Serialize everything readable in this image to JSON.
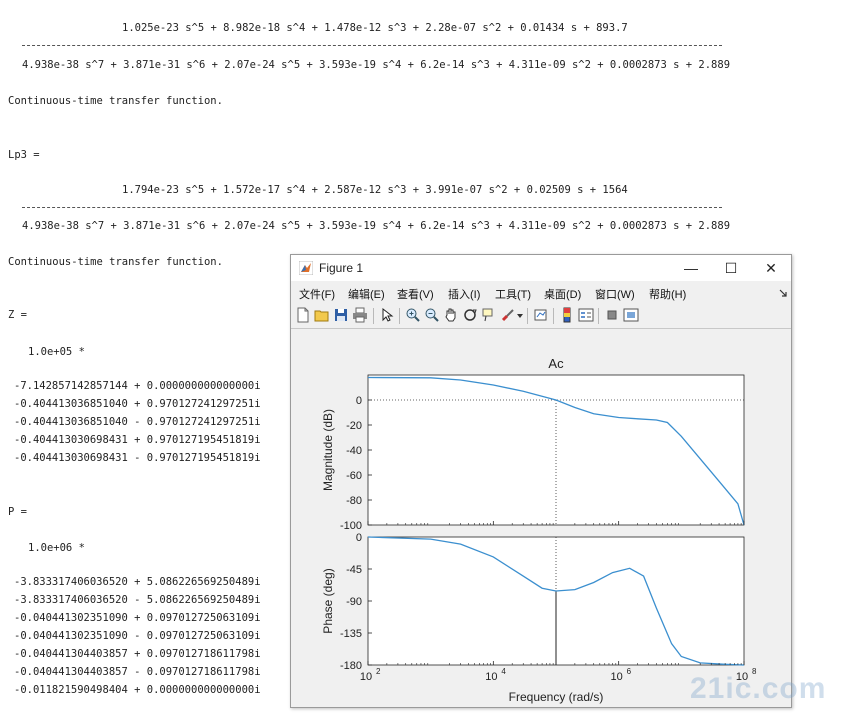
{
  "console": {
    "tf1": {
      "numerator": "1.025e-23 s^5 + 8.982e-18 s^4 + 1.478e-12 s^3 + 2.28e-07 s^2 + 0.01434 s + 893.7",
      "denominator": "4.938e-38 s^7 + 3.871e-31 s^6 + 2.07e-24 s^5 + 3.593e-19 s^4 + 6.2e-14 s^3 + 4.311e-09 s^2 + 0.0002873 s + 2.889",
      "note": "Continuous-time transfer function."
    },
    "lp3": {
      "label": "Lp3 =",
      "numerator": "1.794e-23 s^5 + 1.572e-17 s^4 + 2.587e-12 s^3 + 3.991e-07 s^2 + 0.02509 s + 1564",
      "denominator": "4.938e-38 s^7 + 3.871e-31 s^6 + 2.07e-24 s^5 + 3.593e-19 s^4 + 6.2e-14 s^3 + 4.311e-09 s^2 + 0.0002873 s + 2.889",
      "note": "Continuous-time transfer function."
    },
    "z": {
      "label": "Z =",
      "scale": "1.0e+05 *",
      "values": [
        "-7.142857142857144 + 0.000000000000000i",
        "-0.404413036851040 + 0.970127241297251i",
        "-0.404413036851040 - 0.970127241297251i",
        "-0.404413030698431 + 0.970127195451819i",
        "-0.404413030698431 - 0.970127195451819i"
      ]
    },
    "p": {
      "label": "P =",
      "scale": "1.0e+06 *",
      "values": [
        "-3.833317406036520 + 5.086226569250489i",
        "-3.833317406036520 - 5.086226569250489i",
        "-0.040441302351090 + 0.097012725063109i",
        "-0.040441302351090 - 0.097012725063109i",
        "-0.040441304403857 + 0.097012718611798i",
        "-0.040441304403857 - 0.097012718611798i",
        "-0.011821590498404 + 0.000000000000000i"
      ]
    }
  },
  "figure": {
    "title": "Figure 1",
    "menu": [
      "文件(F)",
      "编辑(E)",
      "查看(V)",
      "插入(I)",
      "工具(T)",
      "桌面(D)",
      "窗口(W)",
      "帮助(H)"
    ],
    "window_buttons": {
      "minimize": "—",
      "maximize": "☐",
      "close": "✕"
    }
  },
  "chart_data": [
    {
      "type": "line",
      "title": "Ac",
      "ylabel": "Magnitude (dB)",
      "xlabel": "",
      "xscale": "log",
      "xlim": [
        100,
        100000000
      ],
      "ylim": [
        -100,
        20
      ],
      "yticks": [
        "0",
        "-20",
        "-40",
        "-60",
        "-80",
        "-100"
      ],
      "ytick_values": [
        0,
        -20,
        -40,
        -60,
        -80,
        -100
      ],
      "grid": "zero line dotted",
      "color": "#3b8fcf",
      "x": [
        100,
        1000,
        3000,
        10000,
        30000,
        100000,
        200000,
        400000,
        1000000,
        2000000,
        4000000,
        6000000,
        10000000,
        20000000,
        40000000,
        80000000,
        100000000
      ],
      "y": [
        18,
        17.8,
        16,
        12,
        7,
        0,
        -6,
        -11,
        -14,
        -15,
        -16,
        -18,
        -29,
        -47,
        -65,
        -83,
        -100
      ],
      "marker": {
        "x": 100000,
        "y": 0
      }
    },
    {
      "type": "line",
      "title": "",
      "ylabel": "Phase (deg)",
      "xlabel": "Frequency  (rad/s)",
      "xscale": "log",
      "xlim": [
        100,
        100000000
      ],
      "ylim": [
        -180,
        0
      ],
      "yticks": [
        "0",
        "-45",
        "-90",
        "-135",
        "-180"
      ],
      "ytick_values": [
        0,
        -45,
        -90,
        -135,
        -180
      ],
      "xticks": [
        "10",
        "10",
        "10",
        "10"
      ],
      "xtick_exponents": [
        "2",
        "4",
        "6",
        "8"
      ],
      "xtick_values": [
        100,
        10000,
        1000000,
        100000000
      ],
      "color": "#3b8fcf",
      "x": [
        100,
        1000,
        3000,
        10000,
        30000,
        60000,
        100000,
        200000,
        400000,
        800000,
        1500000,
        2500000,
        4000000,
        7000000,
        10000000,
        20000000,
        50000000,
        100000000
      ],
      "y": [
        0,
        -3,
        -10,
        -28,
        -55,
        -72,
        -76,
        -74,
        -64,
        -50,
        -44,
        -55,
        -100,
        -150,
        -168,
        -177,
        -179,
        -180
      ],
      "marker": {
        "x": 100000,
        "y": -76
      }
    }
  ],
  "watermark": "21ic.com"
}
